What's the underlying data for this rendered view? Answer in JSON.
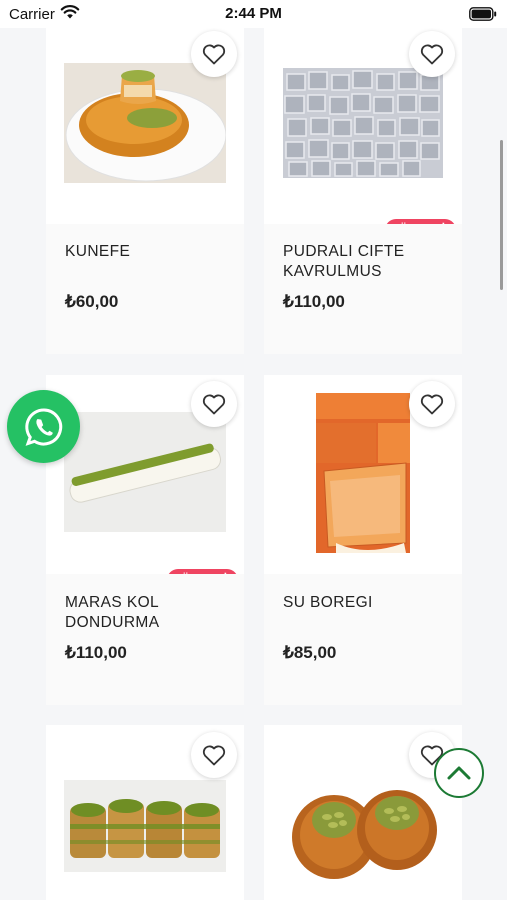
{
  "status_bar": {
    "carrier": "Carrier",
    "time": "2:44 PM"
  },
  "products": [
    {
      "name": "KUNEFE",
      "price": "₺60,00",
      "badge": ""
    },
    {
      "name": "PUDRALI CIFTE\nKAVRULMUS",
      "price": "₺110,00",
      "badge": "TÜKENDİ!"
    },
    {
      "name": "MARAS KOL\nDONDURMA",
      "price": "₺110,00",
      "badge": "TÜKENDİ!"
    },
    {
      "name": "SU BOREGI",
      "price": "₺85,00",
      "badge": ""
    },
    {
      "name": "",
      "price": "",
      "badge": ""
    },
    {
      "name": "",
      "price": "",
      "badge": ""
    }
  ],
  "icons": {
    "favorite": "heart-outline-icon",
    "whatsapp": "whatsapp-icon",
    "scroll_top": "chevron-up-icon"
  },
  "colors": {
    "badge": "#ef4461",
    "whatsapp": "#25c164",
    "scroll_top": "#1c7a34"
  }
}
